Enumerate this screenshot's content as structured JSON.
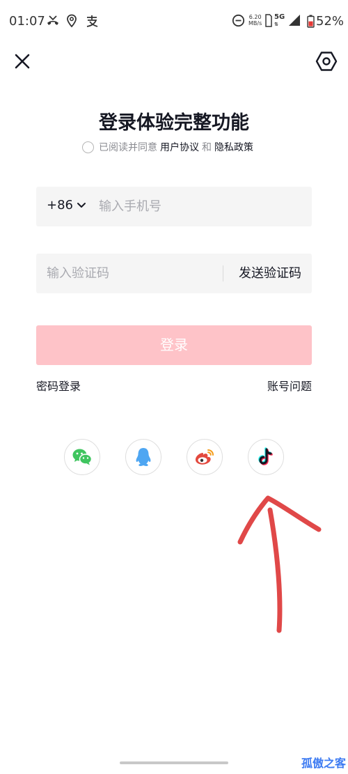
{
  "status_bar": {
    "time": "01:07",
    "net_speed_value": "6.20",
    "net_speed_unit": "MB/s",
    "network": "5G",
    "battery_percent": "52%",
    "battery_level": 0.52
  },
  "header": {
    "title": "登录体验完整功能"
  },
  "agreement": {
    "prefix": "已阅读并同意",
    "user_agreement": "用户协议",
    "and": "和",
    "privacy_policy": "隐私政策"
  },
  "phone": {
    "country_code": "+86",
    "placeholder": "输入手机号",
    "value": ""
  },
  "code": {
    "placeholder": "输入验证码",
    "value": "",
    "send_label": "发送验证码"
  },
  "login_label": "登录",
  "links": {
    "password_login": "密码登录",
    "account_issue": "账号问题"
  },
  "social_icons": [
    "wechat-icon",
    "qq-icon",
    "weibo-icon",
    "douyin-icon"
  ],
  "colors": {
    "login_disabled": "#fec3c8",
    "annotation_arrow": "#e04848",
    "wechat": "#3fc55f",
    "qq": "#4ea6f2",
    "weibo": "#e3493e",
    "douyin_cyan": "#25f4ee",
    "douyin_red": "#fe2c55"
  },
  "watermark": "孤傲之客"
}
